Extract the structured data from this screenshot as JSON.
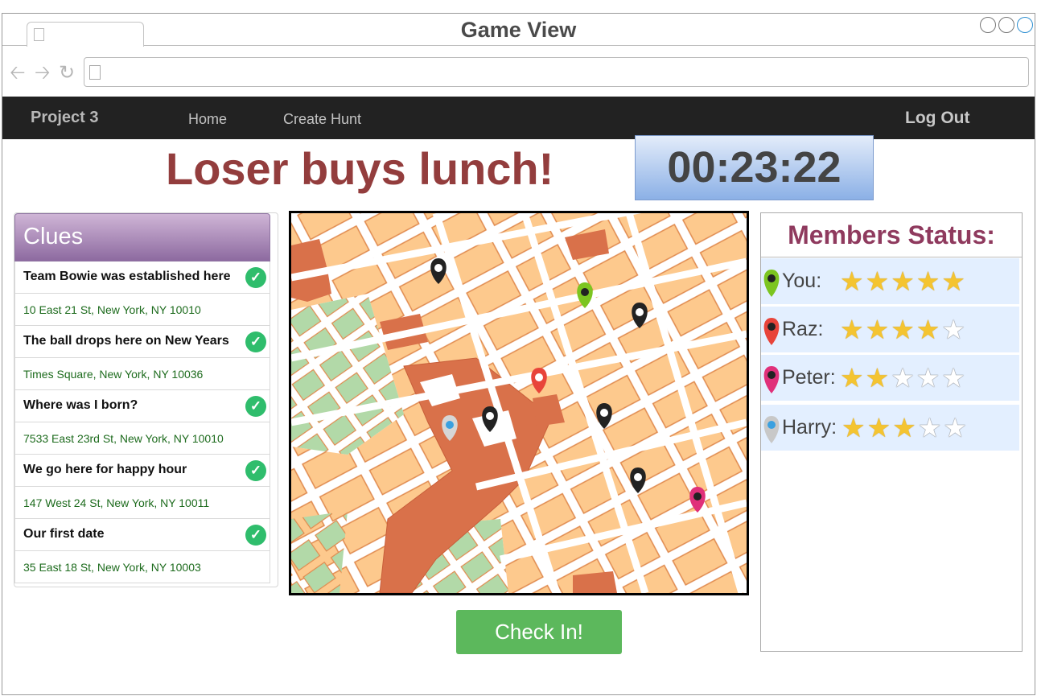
{
  "window": {
    "title": "Game View"
  },
  "navbar": {
    "brand": "Project 3",
    "links": [
      {
        "label": "Home"
      },
      {
        "label": "Create Hunt"
      }
    ],
    "logout": "Log Out"
  },
  "headline": "Loser buys lunch!",
  "timer": "00:23:22",
  "clues": {
    "title": "Clues",
    "items": [
      {
        "question": "Team Bowie was established here",
        "answer": "10 East 21 St, New York, NY 10010",
        "completed": true
      },
      {
        "question": "The ball drops here on New Years",
        "answer": "Times Square, New York, NY 10036",
        "completed": true
      },
      {
        "question": "Where was I born?",
        "answer": "7533 East 23rd St, New York, NY 10010",
        "completed": true
      },
      {
        "question": "We go here for happy hour",
        "answer": "147 West 24 St, New York, NY 10011",
        "completed": true
      },
      {
        "question": "Our first date",
        "answer": "35 East 18 St, New York, NY 10003",
        "completed": true
      }
    ]
  },
  "check_in_button": "Check In!",
  "members": {
    "title": "Members Status:",
    "list": [
      {
        "name": "You:",
        "rating": 5,
        "max": 5,
        "pin_color": "#7cc520"
      },
      {
        "name": "Raz:",
        "rating": 4,
        "max": 5,
        "pin_color": "#e8443a"
      },
      {
        "name": "Peter:",
        "rating": 2,
        "max": 5,
        "pin_color": "#e0307a"
      },
      {
        "name": "Harry:",
        "rating": 3,
        "max": 5,
        "pin_color": "#c8c8c8"
      }
    ]
  },
  "colors": {
    "headline": "#933d3d",
    "members_title": "#8f3a5e",
    "check_in": "#5cb85c",
    "navbar": "#222222"
  }
}
